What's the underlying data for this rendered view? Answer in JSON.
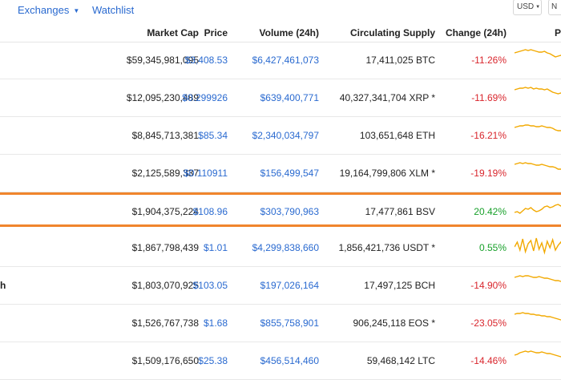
{
  "nav": {
    "exchanges_label": "Exchanges",
    "watchlist_label": "Watchlist",
    "currency_value": "USD",
    "extra_select_value": "N"
  },
  "columns": {
    "market_cap": "Market Cap",
    "price": "Price",
    "volume": "Volume (24h)",
    "supply": "Circulating Supply",
    "change": "Change (24h)",
    "chart": "P"
  },
  "colors": {
    "link": "#2a6ad0",
    "negative": "#d9262d",
    "positive": "#18a02a",
    "highlight": "#f0852d",
    "sparkline": "#f2a900"
  },
  "rows": [
    {
      "name_fragment": "",
      "market_cap": "$59,345,981,095",
      "price": "$3,408.53",
      "volume": "$6,427,461,073",
      "supply": "17,411,025 BTC",
      "change": "-11.26%",
      "direction": "neg",
      "spark": [
        6,
        5,
        4,
        3,
        2,
        3,
        2,
        3,
        4,
        5,
        5,
        4,
        6,
        7,
        9,
        11,
        10,
        9,
        11
      ]
    },
    {
      "name_fragment": "",
      "market_cap": "$12,095,230,489",
      "price": "$0.299926",
      "volume": "$639,400,771",
      "supply": "40,327,341,704 XRP *",
      "change": "-11.69%",
      "direction": "neg",
      "spark": [
        5,
        4,
        3,
        3,
        2,
        3,
        2,
        4,
        3,
        4,
        4,
        5,
        4,
        6,
        8,
        9,
        10,
        9,
        11
      ]
    },
    {
      "name_fragment": "",
      "market_cap": "$8,845,713,381",
      "price": "$85.34",
      "volume": "$2,340,034,797",
      "supply": "103,651,648 ETH",
      "change": "-16.21%",
      "direction": "neg",
      "spark": [
        5,
        4,
        3,
        3,
        2,
        2,
        3,
        3,
        4,
        4,
        3,
        4,
        5,
        5,
        6,
        8,
        9,
        9,
        10
      ]
    },
    {
      "name_fragment": "",
      "market_cap": "$2,125,589,337",
      "price": "$0.110911",
      "volume": "$156,499,547",
      "supply": "19,164,799,806 XLM *",
      "change": "-19.19%",
      "direction": "neg",
      "spark": [
        4,
        3,
        2,
        3,
        2,
        3,
        3,
        4,
        5,
        5,
        4,
        5,
        6,
        7,
        7,
        8,
        10,
        10,
        11
      ]
    },
    {
      "name_fragment": "",
      "market_cap": "$1,904,375,224",
      "price": "$108.96",
      "volume": "$303,790,963",
      "supply": "17,477,861 BSV",
      "change": "20.42%",
      "direction": "pos",
      "spark": [
        16,
        15,
        17,
        14,
        11,
        12,
        10,
        13,
        15,
        14,
        12,
        9,
        8,
        10,
        9,
        7,
        6,
        8,
        7
      ]
    },
    {
      "name_fragment": "",
      "market_cap": "$1,867,798,439",
      "price": "$1.01",
      "volume": "$4,299,838,660",
      "supply": "1,856,421,736 USDT *",
      "change": "0.55%",
      "direction": "pos",
      "spark": [
        14,
        8,
        18,
        4,
        20,
        10,
        6,
        19,
        3,
        17,
        9,
        21,
        7,
        15,
        5,
        18,
        12,
        8,
        16
      ]
    },
    {
      "name_fragment": "h",
      "market_cap": "$1,803,070,925",
      "price": "$103.05",
      "volume": "$197,026,164",
      "supply": "17,497,125 BCH",
      "change": "-14.90%",
      "direction": "neg",
      "spark": [
        5,
        4,
        3,
        4,
        3,
        3,
        4,
        5,
        5,
        4,
        5,
        6,
        6,
        7,
        8,
        9,
        9,
        10,
        11
      ]
    },
    {
      "name_fragment": "",
      "market_cap": "$1,526,767,738",
      "price": "$1.68",
      "volume": "$855,758,901",
      "supply": "906,245,118 EOS *",
      "change": "-23.05%",
      "direction": "neg",
      "spark": [
        4,
        3,
        3,
        2,
        3,
        3,
        4,
        4,
        5,
        5,
        6,
        6,
        7,
        7,
        8,
        9,
        10,
        11,
        12
      ]
    },
    {
      "name_fragment": "",
      "market_cap": "$1,509,176,650",
      "price": "$25.38",
      "volume": "$456,514,460",
      "supply": "59,468,142 LTC",
      "change": "-14.46%",
      "direction": "neg",
      "spark": [
        8,
        7,
        5,
        4,
        3,
        4,
        3,
        4,
        5,
        5,
        4,
        5,
        6,
        6,
        7,
        8,
        9,
        10,
        11
      ]
    }
  ]
}
